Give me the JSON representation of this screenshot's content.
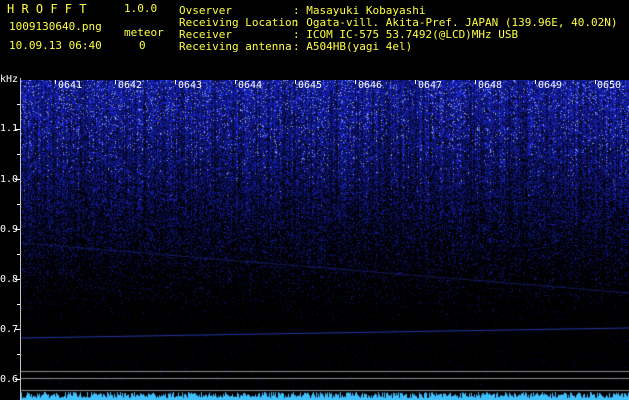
{
  "app": {
    "title": "H R O F F T",
    "version": "1.0.0"
  },
  "file": {
    "name": "1009130640.png",
    "datetime": "10.09.13 06:40"
  },
  "meteor": {
    "label": "meteor",
    "count": "0"
  },
  "info": [
    {
      "key": "Ovserver",
      "value": ": Masayuki Kobayashi"
    },
    {
      "key": "Receiving Location",
      "value": ": Ogata-vill. Akita-Pref. JAPAN (139.96E, 40.02N)"
    },
    {
      "key": "Receiver",
      "value": ": ICOM IC-575 53.7492(@LCD)MHz USB"
    },
    {
      "key": "Receiving antenna",
      "value": ": A504HB(yagi 4el)"
    }
  ],
  "yaxis": {
    "unit": "kHz",
    "ticks": [
      {
        "label": "1.1",
        "value": 1.1
      },
      {
        "label": "1.0",
        "value": 1.0
      },
      {
        "label": "0.9",
        "value": 0.9
      },
      {
        "label": "0.8",
        "value": 0.8
      },
      {
        "label": "0.7",
        "value": 0.7
      },
      {
        "label": "0.6",
        "value": 0.6
      }
    ]
  },
  "xaxis": {
    "ticks": [
      "0641",
      "0642",
      "0643",
      "0644",
      "0645",
      "0646",
      "0647",
      "0648",
      "0649",
      "0650"
    ]
  }
}
